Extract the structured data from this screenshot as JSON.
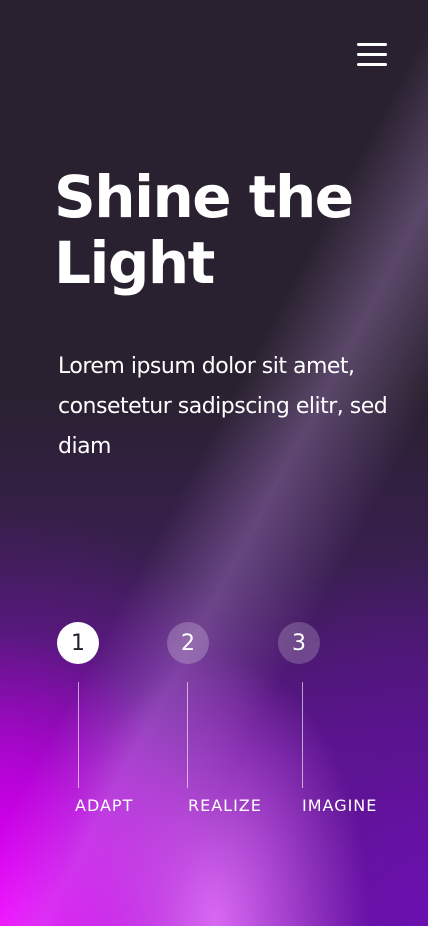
{
  "header": {
    "menu_icon": "hamburger-menu-icon"
  },
  "hero": {
    "title": "Shine the Light",
    "text": "Lorem ipsum dolor sit amet, consetetur sadipscing elitr, sed diam"
  },
  "steps": [
    {
      "number": "1",
      "label": "ADAPT",
      "active": true
    },
    {
      "number": "2",
      "label": "REALIZE",
      "active": false
    },
    {
      "number": "3",
      "label": "IMAGINE",
      "active": false
    }
  ],
  "colors": {
    "background": "#29212f",
    "accent_magenta": "#f200ff",
    "accent_purple": "#7a0fb0",
    "text": "#ffffff"
  }
}
